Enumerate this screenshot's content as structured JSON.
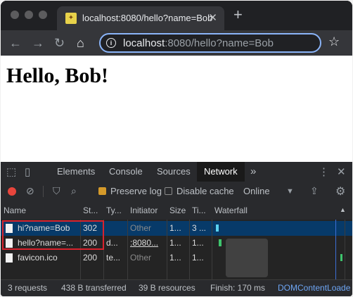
{
  "browser": {
    "tab_title": "localhost:8080/hello?name=Bob",
    "url_host": "localhost",
    "url_rest": ":8080/hello?name=Bob"
  },
  "page": {
    "heading": "Hello, Bob!"
  },
  "devtools": {
    "tabs": [
      "Elements",
      "Console",
      "Sources",
      "Network"
    ],
    "active_tab": "Network",
    "more": "»",
    "network": {
      "preserve_log": "Preserve log",
      "disable_cache": "Disable cache",
      "throttling": "Online",
      "columns": [
        "Name",
        "St...",
        "Ty...",
        "Initiator",
        "Size",
        "Ti...",
        "Waterfall"
      ],
      "rows": [
        {
          "name": "hi?name=Bob",
          "status": "302",
          "type": "",
          "initiator": "Other",
          "size": "1...",
          "time": "3 ..."
        },
        {
          "name": "hello?name=...",
          "status": "200",
          "type": "d...",
          "initiator": ":8080...",
          "size": "1...",
          "time": "1..."
        },
        {
          "name": "favicon.ico",
          "status": "200",
          "type": "te...",
          "initiator": "Other",
          "size": "1...",
          "time": "1..."
        }
      ]
    },
    "status": {
      "requests": "3 requests",
      "transferred": "438 B transferred",
      "resources": "39 B resources",
      "finish": "Finish: 170 ms",
      "dcl": "DOMContentLoade"
    }
  },
  "colors": {
    "accent": "#8ab4f8",
    "selected_row": "#073a69",
    "record": "#e8453c",
    "highlight_box": "#d9232d"
  }
}
